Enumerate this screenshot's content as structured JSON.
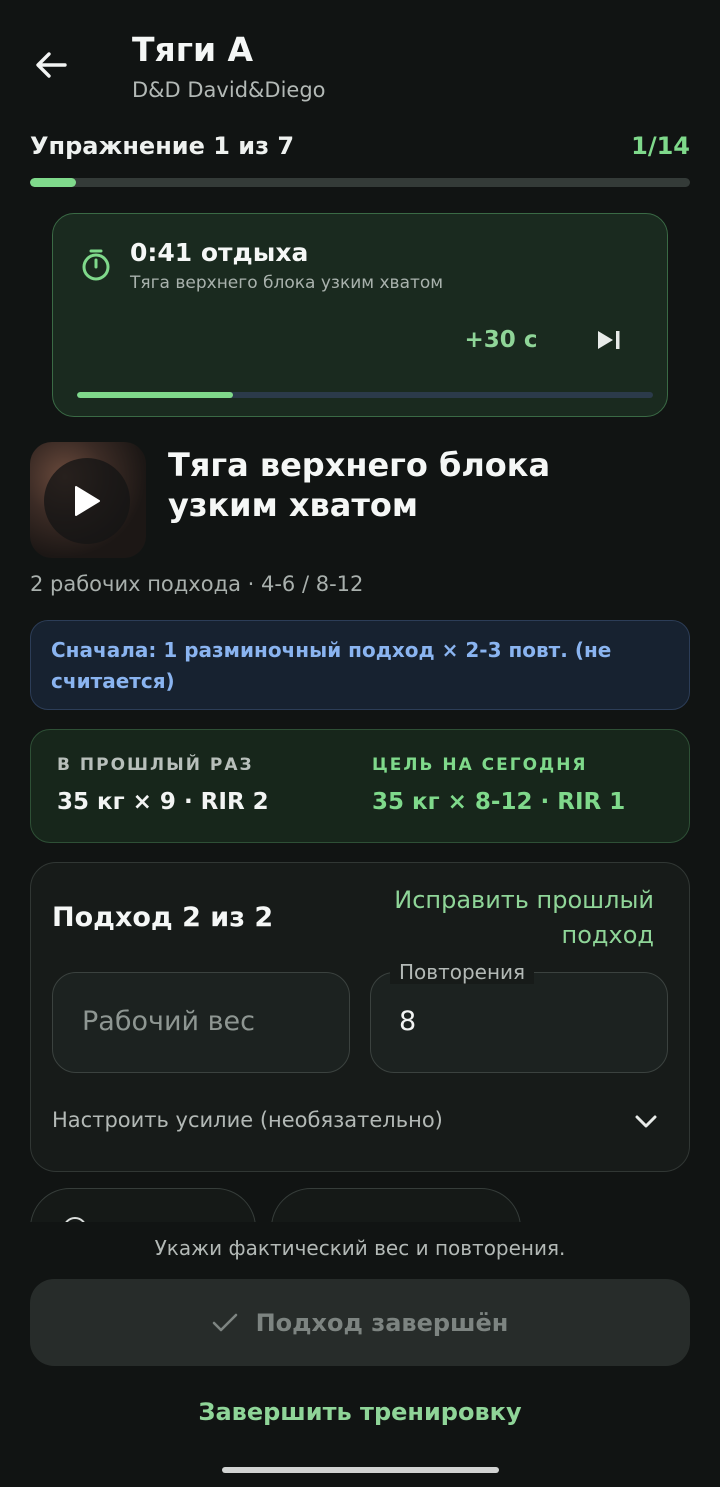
{
  "header": {
    "title": "Тяги А",
    "subtitle": "D&D David&Diego",
    "back_icon": "arrow-left-icon"
  },
  "progress": {
    "label": "Упражнение 1 из 7",
    "count": "1/14",
    "fraction": 0.07
  },
  "rest_timer": {
    "icon": "timer-icon",
    "time_label": "0:41 отдыха",
    "exercise": "Тяга верхнего блока узким хватом",
    "add_label": "+30 с",
    "skip_icon": "skip-next-icon",
    "fraction": 0.27
  },
  "exercise": {
    "video_icon": "play-icon",
    "title": "Тяга верхнего блока узким хватом",
    "meta": "2 рабочих подхода · 4-6 / 8-12",
    "warmup_note": "Сначала: 1 разминочный подход × 2-3 повт. (не считается)"
  },
  "comparison": {
    "last_label": "В ПРОШЛЫЙ РАЗ",
    "last_value": "35 кг × 9 · RIR 2",
    "goal_label": "ЦЕЛЬ НА СЕГОДНЯ",
    "goal_value": "35 кг × 8-12 · RIR 1"
  },
  "set": {
    "title": "Подход 2 из 2",
    "fix_link": "Исправить прошлый подход",
    "weight_placeholder": "Рабочий вес",
    "reps_label": "Повторения",
    "reps_value": "8",
    "effort_label": "Настроить усилие (необязательно)",
    "effort_icon": "chevron-down-icon"
  },
  "footer": {
    "hint": "Укажи фактический вес и повторения.",
    "done_label": "Подход завершён",
    "done_icon": "check-icon",
    "finish_label": "Завершить тренировку"
  },
  "colors": {
    "accent": "#7fd98b",
    "background": "#111413",
    "note_text": "#8ab4f0"
  }
}
